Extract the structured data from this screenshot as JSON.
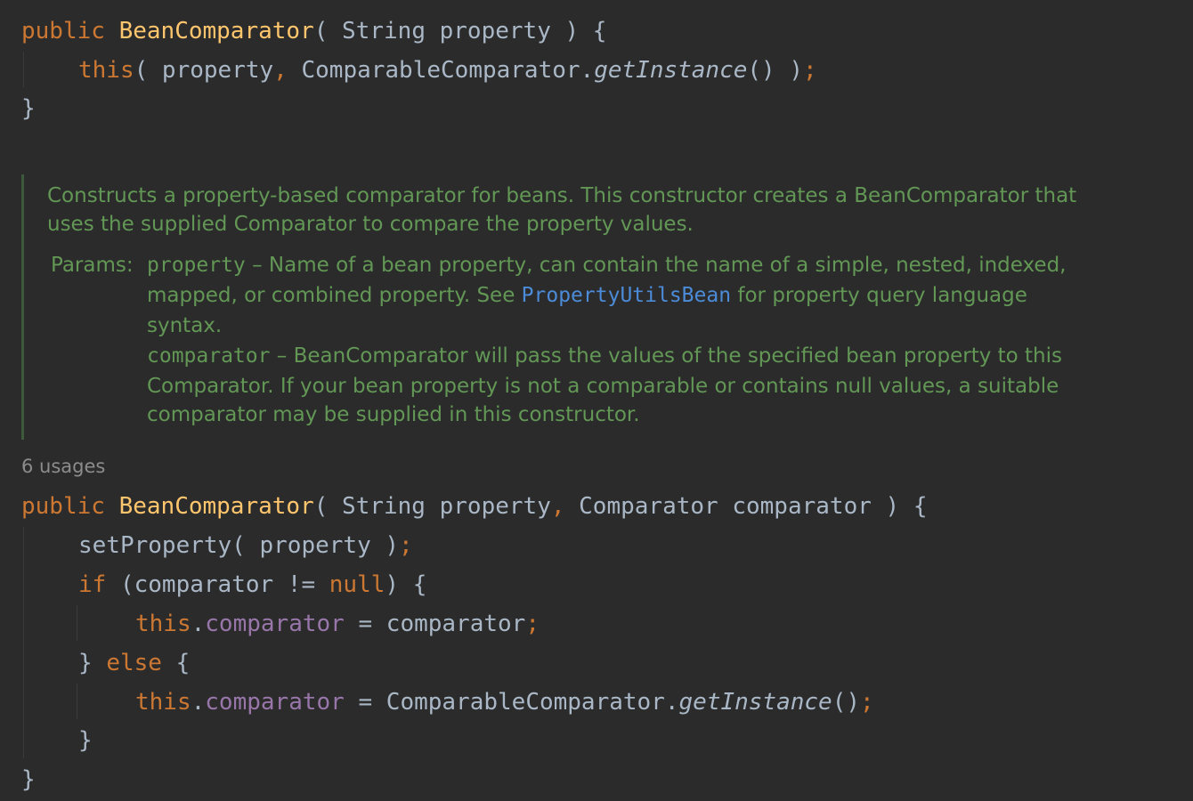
{
  "editor": {
    "constructor1": {
      "line1": {
        "kw_public": "public",
        "name": "BeanComparator",
        "open": "( ",
        "type": "String",
        "param": " property ) {"
      },
      "line2": {
        "kw_this": "this",
        "args": "( property",
        "comma": ",",
        "class_ref": " ComparableComparator.",
        "method": "getInstance",
        "close": "() )",
        "semi": ";"
      },
      "line3": {
        "brace": "}"
      }
    },
    "javadoc": {
      "desc_line1": "Constructs a property-based comparator for beans. This constructor creates a BeanComparator that",
      "desc_line2": "uses the supplied Comparator to compare the property values.",
      "params_label": "Params:",
      "param1_name": "property",
      "param1_line1": " – Name of a bean property, can contain the name of a simple, nested, indexed,",
      "param1_line2_pre": "mapped, or combined property. See ",
      "param1_link": "PropertyUtilsBean",
      "param1_line2_post": " for property query language",
      "param1_line3": "syntax.",
      "param2_name": "comparator",
      "param2_line1": " – BeanComparator will pass the values of the specified bean property to this",
      "param2_line2": "Comparator. If your bean property is not a comparable or contains null values, a suitable",
      "param2_line3": "comparator may be supplied in this constructor."
    },
    "usages_hint": "6 usages",
    "constructor2": {
      "line1": {
        "kw_public": "public",
        "name": "BeanComparator",
        "open": "( String property",
        "comma": ",",
        "rest": " Comparator comparator ) {"
      },
      "line2": {
        "call": "setProperty( property )",
        "semi": ";"
      },
      "line3": {
        "kw_if": "if",
        "cond_open": " (comparator != ",
        "kw_null": "null",
        "cond_close": ") {"
      },
      "line4": {
        "kw_this": "this",
        "dot": ".",
        "field": "comparator",
        "assign": " = comparator",
        "semi": ";"
      },
      "line5": {
        "brace_close": "} ",
        "kw_else": "else",
        "brace_open": " {"
      },
      "line6": {
        "kw_this": "this",
        "dot": ".",
        "field": "comparator",
        "assign": " = ComparableComparator.",
        "method": "getInstance",
        "close": "()",
        "semi": ";"
      },
      "line7": {
        "brace": "}"
      },
      "line8": {
        "brace": "}"
      }
    }
  }
}
